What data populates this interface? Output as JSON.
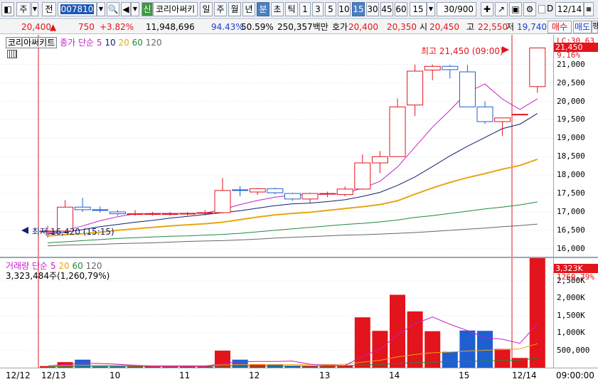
{
  "toolbar": {
    "type_sel": "주",
    "period_btn": "전",
    "code_value": "007810",
    "stock_badge": "신",
    "stock_name": "코리아써키",
    "periods": [
      "일",
      "주",
      "월",
      "년",
      "분",
      "초",
      "틱"
    ],
    "active_period": "분",
    "intervals": [
      "1",
      "3",
      "5",
      "10",
      "15",
      "30",
      "45",
      "60"
    ],
    "active_interval": "15",
    "interval_select": "15",
    "count": "30/900",
    "d_label": "D",
    "date_value": "12/14"
  },
  "quote": {
    "price": "20,400",
    "change_arrow": "▲",
    "change": "750",
    "change_pct": "+3.82%",
    "volume": "11,948,696",
    "vol_ratio": "94.43%",
    "turnover": "50.59%",
    "amount": "250,357백만",
    "ask_label": "호가",
    "ask": "20,400",
    "bid": "20,350",
    "open_label": "시",
    "open": "20,450",
    "high_label": "고",
    "high": "22,550",
    "low_label": "저",
    "low": "19,740",
    "buy_btn": "매수",
    "sell_btn": "매도",
    "eval_btn": "평"
  },
  "price_panel": {
    "chart_name": "코리아써키트",
    "ma_label": "종가 단순",
    "ma_periods": [
      "5",
      "10",
      "20",
      "60",
      "120"
    ],
    "high_annot": "최고 21,450 (09:00)",
    "low_annot": "최저 16,420 (15:15)",
    "axis_top": "LC:30.63",
    "current_tag": "21,450",
    "current_pct": "9.16%",
    "ticks": [
      "21,000",
      "20,500",
      "20,000",
      "19,500",
      "19,000",
      "18,500",
      "18,000",
      "17,500",
      "17,000",
      "16,500",
      "16,000"
    ]
  },
  "volume_panel": {
    "label": "거래량",
    "ma_label": "단순",
    "ma_periods": [
      "5",
      "20",
      "60",
      "120"
    ],
    "info": "3,323,484주(1,260,79%)",
    "tag_value": "3,323K",
    "tag_pct": "1260,79%",
    "ticks": [
      "2,500K",
      "2,000K",
      "1,500K",
      "1,000K",
      "500,000"
    ]
  },
  "xaxis": {
    "labels": [
      "12/12",
      "12/13",
      "10",
      "11",
      "12",
      "13",
      "14",
      "15",
      "12/14"
    ],
    "time": "09:00:00"
  },
  "colors": {
    "up": "#e3141b",
    "down": "#1f5fd1",
    "ma5": "#c81fc8",
    "ma10": "#10206e",
    "ma20": "#e8a612",
    "ma60": "#1e8a3c",
    "ma120": "#666666"
  },
  "chart_data": {
    "type": "candlestick",
    "x_labels": [
      "12/13",
      "10",
      "11",
      "12",
      "13",
      "14",
      "15",
      "12/14"
    ],
    "candles": [
      {
        "o": 16480,
        "h": 16620,
        "l": 16300,
        "c": 16480
      },
      {
        "o": 16480,
        "h": 17320,
        "l": 16420,
        "c": 17130
      },
      {
        "o": 17130,
        "h": 17380,
        "l": 17000,
        "c": 17060
      },
      {
        "o": 17060,
        "h": 17150,
        "l": 16980,
        "c": 17050
      },
      {
        "o": 17000,
        "h": 17050,
        "l": 16900,
        "c": 16950
      },
      {
        "o": 16950,
        "h": 17050,
        "l": 16900,
        "c": 16950
      },
      {
        "o": 16950,
        "h": 17000,
        "l": 16900,
        "c": 16950
      },
      {
        "o": 16950,
        "h": 17000,
        "l": 16900,
        "c": 16950
      },
      {
        "o": 16950,
        "h": 17000,
        "l": 16900,
        "c": 16960
      },
      {
        "o": 16960,
        "h": 17050,
        "l": 16900,
        "c": 16980
      },
      {
        "o": 16980,
        "h": 17920,
        "l": 16950,
        "c": 17580
      },
      {
        "o": 17600,
        "h": 17700,
        "l": 17420,
        "c": 17580
      },
      {
        "o": 17540,
        "h": 17650,
        "l": 17460,
        "c": 17630
      },
      {
        "o": 17630,
        "h": 17660,
        "l": 17480,
        "c": 17520
      },
      {
        "o": 17500,
        "h": 17520,
        "l": 17300,
        "c": 17350
      },
      {
        "o": 17350,
        "h": 17520,
        "l": 17250,
        "c": 17500
      },
      {
        "o": 17500,
        "h": 17550,
        "l": 17400,
        "c": 17500
      },
      {
        "o": 17470,
        "h": 17690,
        "l": 17420,
        "c": 17620
      },
      {
        "o": 17620,
        "h": 18560,
        "l": 17600,
        "c": 18330
      },
      {
        "o": 18330,
        "h": 18650,
        "l": 18050,
        "c": 18500
      },
      {
        "o": 18500,
        "h": 20080,
        "l": 18500,
        "c": 19850
      },
      {
        "o": 19900,
        "h": 21000,
        "l": 19600,
        "c": 20820
      },
      {
        "o": 20850,
        "h": 21000,
        "l": 20570,
        "c": 20950
      },
      {
        "o": 20950,
        "h": 20990,
        "l": 20620,
        "c": 20860
      },
      {
        "o": 20800,
        "h": 20990,
        "l": 20240,
        "c": 19850
      },
      {
        "o": 19850,
        "h": 20000,
        "l": 19390,
        "c": 19450
      },
      {
        "o": 19450,
        "h": 19560,
        "l": 19060,
        "c": 19550
      },
      {
        "o": 19650,
        "h": 19660,
        "l": 19640,
        "c": 19650
      },
      {
        "o": 20400,
        "h": 21450,
        "l": 20230,
        "c": 21450
      }
    ],
    "volume": [
      45000,
      160000,
      230000,
      40000,
      35000,
      30000,
      30000,
      30000,
      40000,
      30000,
      490000,
      230000,
      100000,
      80000,
      50000,
      40000,
      50000,
      60000,
      1450000,
      1060000,
      2100000,
      1620000,
      1050000,
      460000,
      1070000,
      1060000,
      540000,
      280000,
      3323484
    ],
    "ma5": [
      16420,
      16500,
      16620,
      16760,
      16870,
      16950,
      16960,
      16960,
      16960,
      16970,
      17060,
      17200,
      17310,
      17400,
      17460,
      17470,
      17480,
      17510,
      17640,
      17830,
      18220,
      18760,
      19300,
      19760,
      20250,
      20470,
      20060,
      19780,
      20070
    ],
    "ma10": [
      16400,
      16450,
      16520,
      16600,
      16660,
      16720,
      16770,
      16830,
      16880,
      16930,
      16980,
      17030,
      17100,
      17170,
      17220,
      17240,
      17280,
      17330,
      17420,
      17530,
      17720,
      17950,
      18230,
      18520,
      18780,
      19020,
      19260,
      19380,
      19670
    ],
    "ma20": [
      16350,
      16380,
      16410,
      16450,
      16500,
      16540,
      16580,
      16620,
      16650,
      16680,
      16720,
      16790,
      16860,
      16920,
      16960,
      16990,
      17040,
      17090,
      17140,
      17200,
      17300,
      17480,
      17650,
      17800,
      17930,
      18040,
      18160,
      18260,
      18430
    ],
    "ma60": [
      16160,
      16190,
      16220,
      16250,
      16280,
      16300,
      16320,
      16340,
      16350,
      16370,
      16390,
      16420,
      16460,
      16500,
      16540,
      16580,
      16620,
      16660,
      16690,
      16730,
      16780,
      16850,
      16900,
      16960,
      17020,
      17080,
      17130,
      17190,
      17270
    ],
    "ma120": [
      16080,
      16100,
      16110,
      16120,
      16140,
      16150,
      16160,
      16180,
      16200,
      16210,
      16220,
      16240,
      16260,
      16290,
      16310,
      16330,
      16350,
      16370,
      16380,
      16400,
      16420,
      16440,
      16470,
      16500,
      16530,
      16560,
      16600,
      16630,
      16670
    ],
    "vol_ma5": [
      50000,
      90000,
      130000,
      120000,
      100000,
      70000,
      35000,
      35000,
      35000,
      35000,
      130000,
      170000,
      180000,
      180000,
      190000,
      100000,
      70000,
      60000,
      330000,
      530000,
      950000,
      1260000,
      1460000,
      1250000,
      1070000,
      860000,
      820000,
      700000,
      1270000
    ],
    "vol_ma20": [
      40000,
      60000,
      70000,
      70000,
      70000,
      60000,
      60000,
      60000,
      60000,
      60000,
      80000,
      90000,
      90000,
      90000,
      90000,
      90000,
      90000,
      100000,
      160000,
      210000,
      310000,
      380000,
      430000,
      450000,
      480000,
      500000,
      520000,
      540000,
      690000
    ],
    "vol_ma60": [
      30000,
      35000,
      40000,
      40000,
      40000,
      40000,
      40000,
      40000,
      40000,
      40000,
      45000,
      50000,
      50000,
      50000,
      50000,
      50000,
      50000,
      55000,
      75000,
      90000,
      120000,
      145000,
      160000,
      170000,
      180000,
      195000,
      210000,
      220000,
      270000
    ],
    "y_price_range": [
      15900,
      21650
    ],
    "y_volume_range": [
      0,
      2950000
    ],
    "grid": true
  }
}
